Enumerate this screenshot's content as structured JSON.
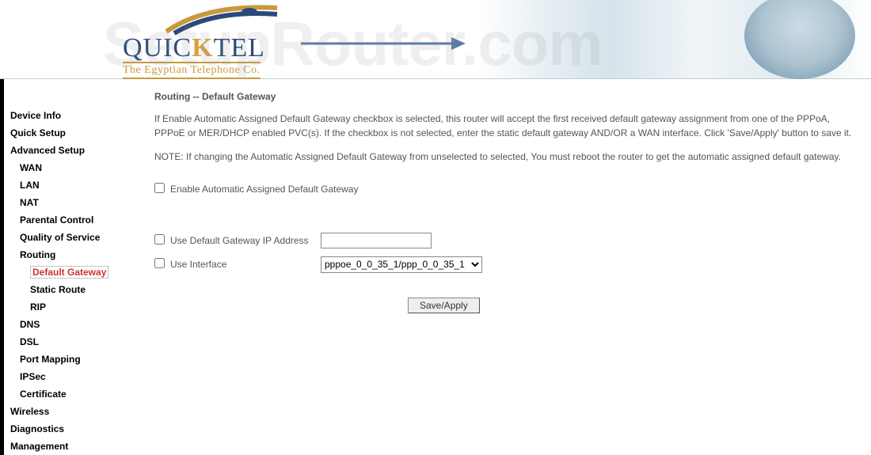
{
  "watermark": "SetupRouter.com",
  "logo": {
    "main_pre": "QUIC",
    "main_k": "K",
    "main_post": "TEL",
    "sub": "The Egyptian Telephone Co."
  },
  "sidebar": {
    "items": [
      {
        "label": "Device Info",
        "cls": "lvl0"
      },
      {
        "label": "Quick Setup",
        "cls": "lvl0"
      },
      {
        "label": "Advanced Setup",
        "cls": "lvl0"
      },
      {
        "label": "WAN",
        "cls": "lvl1"
      },
      {
        "label": "LAN",
        "cls": "lvl1"
      },
      {
        "label": "NAT",
        "cls": "lvl1"
      },
      {
        "label": "Parental Control",
        "cls": "lvl1"
      },
      {
        "label": "Quality of Service",
        "cls": "lvl1"
      },
      {
        "label": "Routing",
        "cls": "lvl1"
      },
      {
        "label": "Default Gateway",
        "cls": "lvl2",
        "selected": true
      },
      {
        "label": "Static Route",
        "cls": "lvl2"
      },
      {
        "label": "RIP",
        "cls": "lvl2"
      },
      {
        "label": "DNS",
        "cls": "lvl1"
      },
      {
        "label": "DSL",
        "cls": "lvl1"
      },
      {
        "label": "Port Mapping",
        "cls": "lvl1"
      },
      {
        "label": "IPSec",
        "cls": "lvl1"
      },
      {
        "label": "Certificate",
        "cls": "lvl1"
      },
      {
        "label": "Wireless",
        "cls": "lvl0"
      },
      {
        "label": "Diagnostics",
        "cls": "lvl0"
      },
      {
        "label": "Management",
        "cls": "lvl0"
      }
    ]
  },
  "main": {
    "title": "Routing -- Default Gateway",
    "desc1": "If Enable Automatic Assigned Default Gateway checkbox is selected, this router will accept the first received default gateway assignment from one of the PPPoA, PPPoE or MER/DHCP enabled PVC(s). If the checkbox is not selected, enter the static default gateway AND/OR a WAN interface. Click 'Save/Apply' button to save it.",
    "desc2": "NOTE: If changing the Automatic Assigned Default Gateway from unselected to selected, You must reboot the router to get the automatic assigned default gateway.",
    "cb_enable": "Enable Automatic Assigned Default Gateway",
    "cb_gwip": "Use Default Gateway IP Address",
    "gwip_value": "",
    "cb_iface": "Use Interface",
    "iface_value": "pppoe_0_0_35_1/ppp_0_0_35_1",
    "save_label": "Save/Apply"
  }
}
